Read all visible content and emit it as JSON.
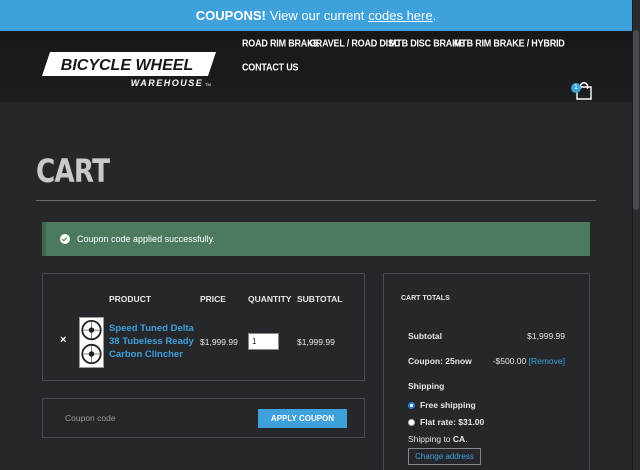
{
  "promo": {
    "lead": "COUPONS!",
    "text": "View our current",
    "link": "codes here",
    "tail": "."
  },
  "logo": {
    "line1": "BICYCLE WHEEL",
    "line2": "WAREHOUSE",
    "tm": "TM"
  },
  "nav": {
    "road_rim_brake": "ROAD RIM BRAKE",
    "gravel_road_disc": "GRAVEL / ROAD DISC",
    "mtb_disc_brake": "MTB DISC BRAKE",
    "mtb_rim_brake": "MTB RIM BRAKE / HYBRID",
    "contact_us": "CONTACT US"
  },
  "cart_count": "1",
  "page_title": "CART",
  "notice": "Coupon code applied successfully.",
  "table": {
    "headers": {
      "product": "PRODUCT",
      "price": "PRICE",
      "quantity": "QUANTITY",
      "subtotal": "SUBTOTAL"
    },
    "remove": "×",
    "item": {
      "name": "Speed Tuned Delta 38 Tubeless Ready Carbon Clincher",
      "price": "$1,999.99",
      "quantity": "1",
      "subtotal": "$1,999.99"
    }
  },
  "coupon": {
    "placeholder": "Coupon code",
    "button": "APPLY COUPON"
  },
  "totals": {
    "title": "CART TOTALS",
    "subtotal_label": "Subtotal",
    "subtotal_value": "$1,999.99",
    "coupon_label": "Coupon: 25now",
    "coupon_value": "-$500.00",
    "coupon_remove": "[Remove]",
    "shipping_label": "Shipping",
    "free_shipping": "Free shipping",
    "flat_rate": "Flat rate: $31.00",
    "shipping_to_prefix": "Shipping to",
    "shipping_to_value": "CA",
    "shipping_to_suffix": ".",
    "change_address": "Change address"
  },
  "colors": {
    "accent": "#3ea1dc",
    "background": "#26272b",
    "header": "#161719",
    "success": "#4d7a5e"
  }
}
